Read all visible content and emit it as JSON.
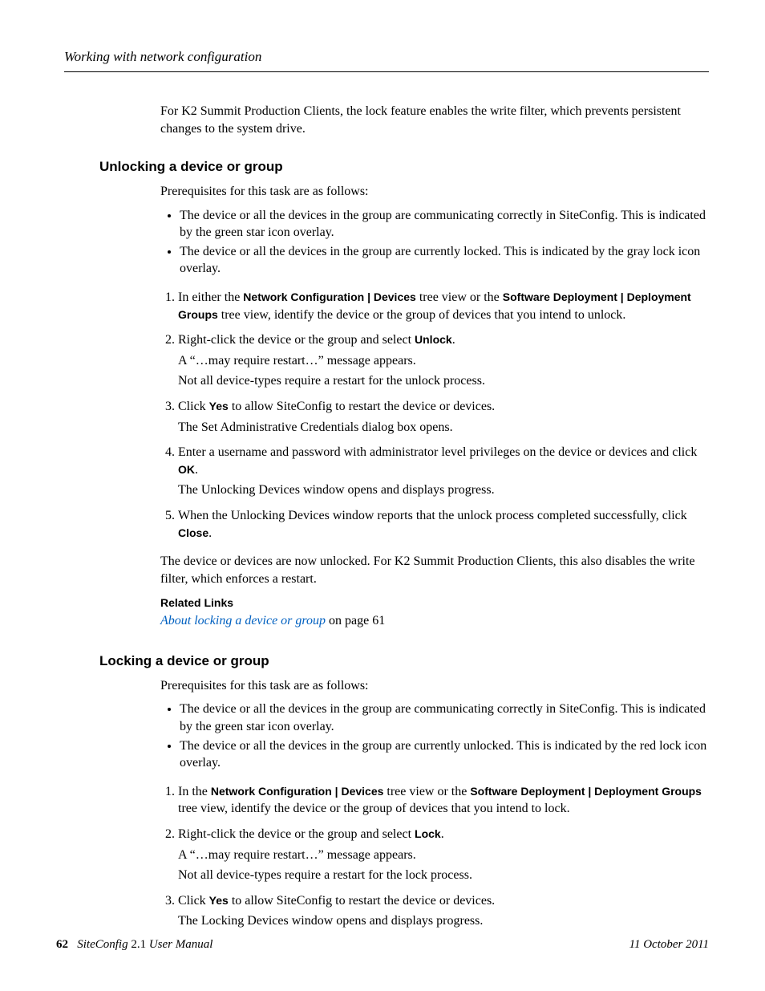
{
  "running_head": "Working with network configuration",
  "intro": "For K2 Summit Production Clients, the lock feature enables the write filter, which prevents persistent changes to the system drive.",
  "s1": {
    "heading": "Unlocking a device or group",
    "prereq": "Prerequisites for this task are as follows:",
    "bullet1": "The device or all the devices in the group are communicating correctly in SiteConfig. This is indicated by the green star icon overlay.",
    "bullet2": "The device or all the devices in the group are currently locked. This is indicated by the gray lock icon overlay.",
    "step1_a": "In either the ",
    "step1_b": "Network Configuration | Devices",
    "step1_c": " tree view or the ",
    "step1_d": "Software Deployment | Deployment Groups",
    "step1_e": " tree view, identify the device or the group of devices that you intend to unlock.",
    "step2_a": "Right-click the device or the group and select ",
    "step2_b": "Unlock",
    "step2_c": ".",
    "step2_sub1": "A “…may require restart…” message appears.",
    "step2_sub2": "Not all device-types require a restart for the unlock process.",
    "step3_a": "Click ",
    "step3_b": "Yes",
    "step3_c": " to allow SiteConfig to restart the device or devices.",
    "step3_sub1": "The Set Administrative Credentials dialog box opens.",
    "step4_a": "Enter a username and password with administrator level privileges on the device or devices and click ",
    "step4_b": "OK",
    "step4_c": ".",
    "step4_sub1": "The Unlocking Devices window opens and displays progress.",
    "step5_a": "When the Unlocking Devices window reports that the unlock process completed successfully, click ",
    "step5_b": "Close",
    "step5_c": ".",
    "closing": "The device or devices are now unlocked. For K2 Summit Production Clients, this also disables the write filter, which enforces a restart.",
    "related_heading": "Related Links",
    "related_link": "About locking a device or group",
    "related_tail": " on page 61"
  },
  "s2": {
    "heading": "Locking a device or group",
    "prereq": "Prerequisites for this task are as follows:",
    "bullet1": "The device or all the devices in the group are communicating correctly in SiteConfig. This is indicated by the green star icon overlay.",
    "bullet2": "The device or all the devices in the group are currently unlocked. This is indicated by the red lock icon overlay.",
    "step1_a": "In the ",
    "step1_b": "Network Configuration | Devices",
    "step1_c": " tree view or the ",
    "step1_d": "Software Deployment | Deployment Groups",
    "step1_e": " tree view, identify the device or the group of devices that you intend to lock.",
    "step2_a": "Right-click the device or the group and select ",
    "step2_b": "Lock",
    "step2_c": ".",
    "step2_sub1": "A “…may require restart…” message appears.",
    "step2_sub2": "Not all device-types require a restart for the lock process.",
    "step3_a": "Click ",
    "step3_b": "Yes",
    "step3_c": " to allow SiteConfig to restart the device or devices.",
    "step3_sub1": "The Locking Devices window opens and displays progress."
  },
  "footer": {
    "page_num": "62",
    "product": "SiteConfig",
    "version": " 2.1 ",
    "manual": "User Manual",
    "date": "11 October 2011"
  }
}
